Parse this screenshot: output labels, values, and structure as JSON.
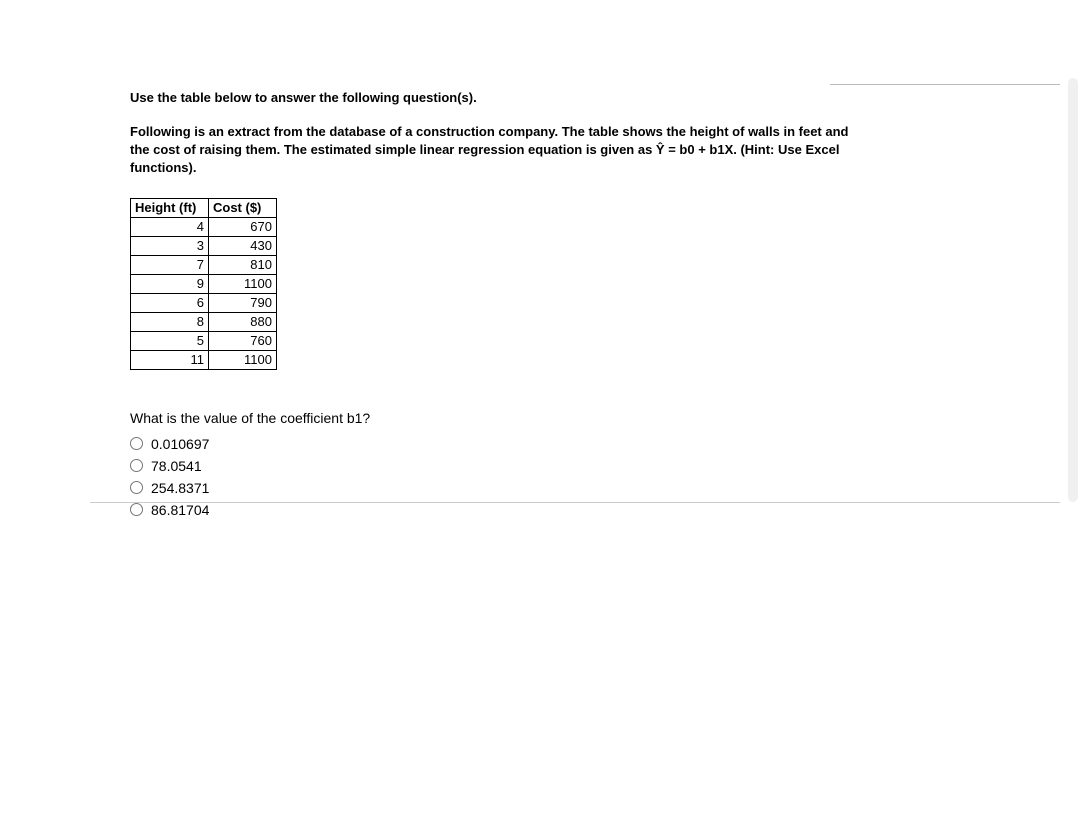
{
  "instruction": "Use the table below to answer the following question(s).",
  "description": "Following is an extract from the database of a construction company. The table shows the height of walls in feet and the cost of raising them. The estimated simple linear regression equation is given as Ŷ = b0 + b1X. (Hint: Use Excel functions).",
  "table": {
    "headers": [
      "Height (ft)",
      "Cost ($)"
    ],
    "rows": [
      {
        "height": "4",
        "cost": "670"
      },
      {
        "height": "3",
        "cost": "430"
      },
      {
        "height": "7",
        "cost": "810"
      },
      {
        "height": "9",
        "cost": "1100"
      },
      {
        "height": "6",
        "cost": "790"
      },
      {
        "height": "8",
        "cost": "880"
      },
      {
        "height": "5",
        "cost": "760"
      },
      {
        "height": "11",
        "cost": "1100"
      }
    ]
  },
  "question": "What is the value of the coefficient  b1?",
  "options": [
    "0.010697",
    "78.0541",
    "254.8371",
    "86.81704"
  ]
}
